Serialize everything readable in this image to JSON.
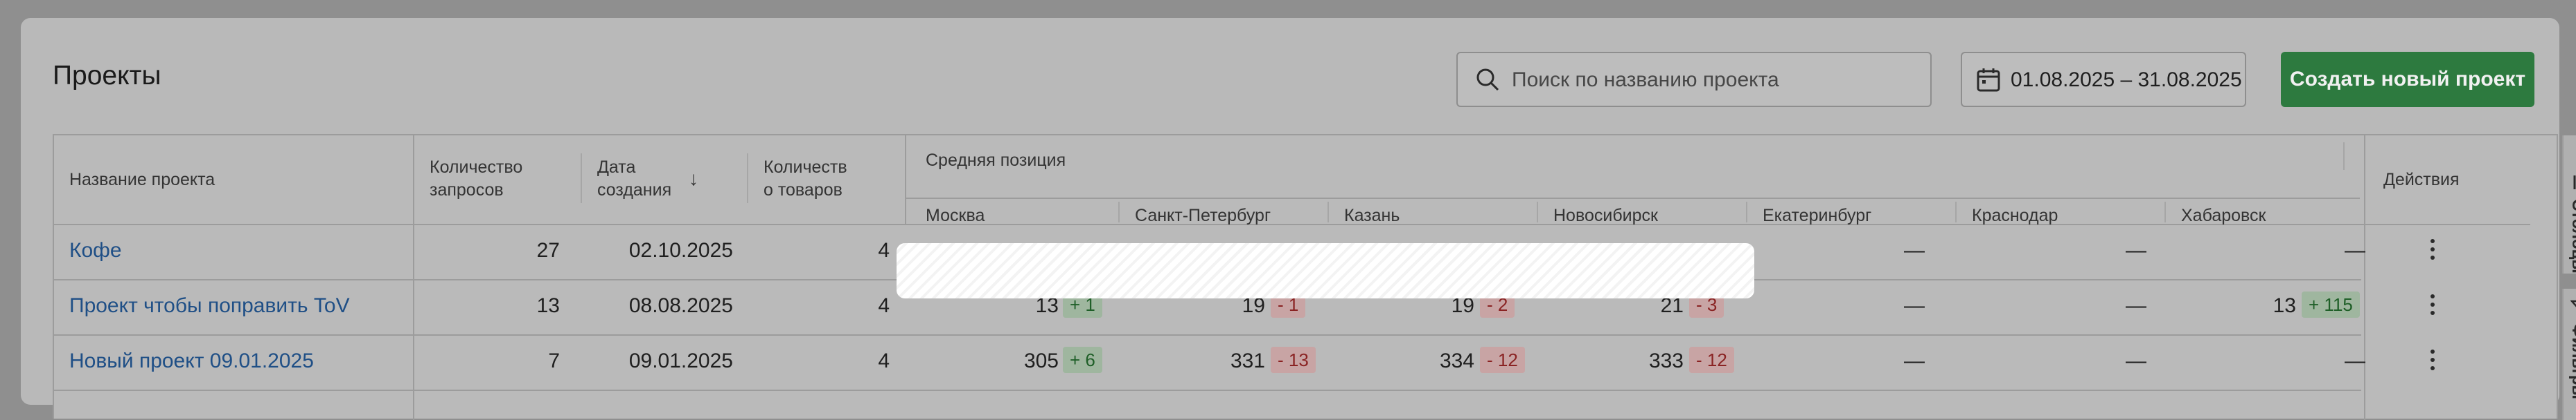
{
  "page": {
    "title": "Проекты",
    "search_placeholder": "Поиск по названию проекта",
    "date_range": "01.08.2025 – 31.08.2025",
    "create_button": "Создать новый проект"
  },
  "table": {
    "headers": {
      "name": "Название проекта",
      "requests_line1": "Количество",
      "requests_line2": "запросов",
      "created_line1": "Дата",
      "created_line2": "создания",
      "sort_arrow": "↓",
      "goods_line1": "Количеств",
      "goods_line2": "о товаров",
      "avg_position": "Средняя позиция",
      "actions": "Действия"
    },
    "cities": [
      "Москва",
      "Санкт-Петербург",
      "Казань",
      "Новосибирск",
      "Екатеринбург",
      "Краснодар",
      "Хабаровск"
    ],
    "rows": [
      {
        "name": "Кофе",
        "requests": "27",
        "created": "02.10.2025",
        "goods": "4",
        "ekb": "—",
        "krd": "—",
        "khv": "—"
      },
      {
        "name": "Проект чтобы поправить ToV",
        "requests": "13",
        "created": "08.08.2025",
        "goods": "4",
        "msk": "13",
        "msk_delta": "+ 1",
        "spb": "19",
        "spb_delta": "- 1",
        "kzn": "19",
        "kzn_delta": "- 2",
        "nsk": "21",
        "nsk_delta": "- 3",
        "ekb": "—",
        "krd": "—",
        "khv": "13",
        "khv_delta": "+ 115"
      },
      {
        "name": "Новый проект 09.01.2025",
        "requests": "7",
        "created": "09.01.2025",
        "goods": "4",
        "msk": "305",
        "msk_delta": "+ 6",
        "spb": "331",
        "spb_delta": "- 13",
        "kzn": "334",
        "kzn_delta": "- 12",
        "nsk": "333",
        "nsk_delta": "- 12",
        "ekb": "—",
        "krd": "—",
        "khv": "—"
      }
    ]
  },
  "side_tabs": {
    "columns": "Столбцы",
    "filters": "Фильтры"
  },
  "colors": {
    "accent_green": "#2d7a3f",
    "link": "#1f4f86",
    "badge_up": "#1f5f28",
    "badge_down": "#8a2323"
  },
  "icons": [
    "search-icon",
    "calendar-icon",
    "sort-down-icon",
    "kebab-menu-icon",
    "columns-icon",
    "filter-icon"
  ]
}
